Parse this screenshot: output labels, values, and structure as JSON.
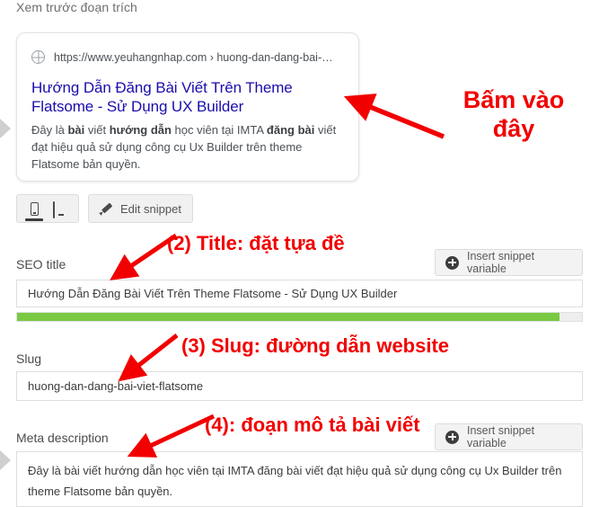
{
  "page": {
    "section_heading": "Xem trước đoạn trích"
  },
  "snippet_preview": {
    "url": "https://www.yeuhangnhap.com › huong-dan-dang-bai-…",
    "title": "Hướng Dẫn Đăng Bài Viết Trên Theme Flatsome - Sử Dụng UX Builder",
    "description_parts": [
      {
        "text": "Đây là ",
        "bold": false
      },
      {
        "text": "bài",
        "bold": true
      },
      {
        "text": " viết ",
        "bold": false
      },
      {
        "text": "hướng dẫn",
        "bold": true
      },
      {
        "text": " học viên tại IMTA ",
        "bold": false
      },
      {
        "text": "đăng bài",
        "bold": true
      },
      {
        "text": " viết đạt hiệu quả sử dụng công cụ Ux Builder trên theme Flatsome bản quyền.",
        "bold": false
      }
    ],
    "globe_icon": "globe-icon"
  },
  "toolbar": {
    "mobile_icon": "mobile-phone-icon",
    "desktop_icon": "desktop-monitor-icon",
    "active_device": "mobile",
    "edit_snippet_label": "Edit snippet",
    "pencil_icon": "pencil-icon"
  },
  "fields": {
    "seo_title": {
      "label": "SEO title",
      "value": "Hướng Dẫn Đăng Bài Viết Trên Theme Flatsome - Sử Dụng UX Builder",
      "insert_variable_label": "Insert snippet variable",
      "plus_icon": "plus-circle-icon"
    },
    "slug": {
      "label": "Slug",
      "value": "huong-dan-dang-bai-viet-flatsome"
    },
    "meta_description": {
      "label": "Meta description",
      "value": "Đây là bài viết hướng dẫn học viên tại IMTA đăng bài viết đạt hiệu quả sử dụng công cụ Ux Builder trên theme Flatsome bản quyền.",
      "insert_variable_label": "Insert snippet variable",
      "plus_icon": "plus-circle-icon"
    }
  },
  "progress": {
    "percent": 96,
    "fill_color": "#7ac943",
    "track_color": "#eeeeee"
  },
  "annotations": {
    "accent_color": "#f20000",
    "click_here_line1": "Bấm vào",
    "click_here_line2": "đây",
    "title_note": "(2) Title: đặt tựa đề",
    "slug_note": "(3) Slug: đường dẫn website",
    "meta_note": "(4): đoạn mô tả bài viết"
  }
}
